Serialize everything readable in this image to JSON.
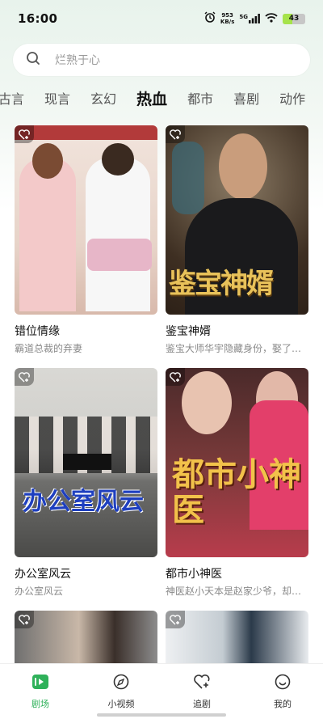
{
  "status": {
    "time": "16:00",
    "net_speed_value": "953",
    "net_speed_unit": "KB/s",
    "signal_label": "5G",
    "battery": "43"
  },
  "search": {
    "placeholder": "烂熟于心"
  },
  "tabs": [
    {
      "label": "古言",
      "active": false
    },
    {
      "label": "现言",
      "active": false
    },
    {
      "label": "玄幻",
      "active": false
    },
    {
      "label": "热血",
      "active": true
    },
    {
      "label": "都市",
      "active": false
    },
    {
      "label": "喜剧",
      "active": false
    },
    {
      "label": "动作",
      "active": false
    }
  ],
  "cards": [
    {
      "title": "错位情缘",
      "desc": "霸道总裁的弃妻",
      "poster_text": "",
      "palette": [
        "#d9c2b6",
        "#f2e4dc"
      ]
    },
    {
      "title": "鉴宝神婿",
      "desc": "鉴宝大师华宇隐藏身份，娶了…",
      "poster_text": "鉴宝神婿",
      "palette": [
        "#3b2a1c",
        "#7a6a55"
      ]
    },
    {
      "title": "办公室风云",
      "desc": "办公室风云",
      "poster_text": "办公室风云",
      "palette": [
        "#c9c9c6",
        "#8e8e8a"
      ]
    },
    {
      "title": "都市小神医",
      "desc": "神医赵小天本是赵家少爷，却…",
      "poster_text": "都市小神医",
      "palette": [
        "#5a2e2a",
        "#d94a5a"
      ]
    },
    {
      "title": "",
      "desc": "",
      "poster_text": "",
      "palette": [
        "#a7a7a7",
        "#5b4a40"
      ]
    },
    {
      "title": "",
      "desc": "",
      "poster_text": "",
      "palette": [
        "#dfe3e6",
        "#9aa4ab"
      ]
    }
  ],
  "nav": [
    {
      "label": "剧场",
      "icon": "theater-icon",
      "active": true
    },
    {
      "label": "小视频",
      "icon": "compass-icon",
      "active": false
    },
    {
      "label": "追剧",
      "icon": "heart-plus-icon",
      "active": false
    },
    {
      "label": "我的",
      "icon": "smile-icon",
      "active": false
    }
  ],
  "colors": {
    "accent": "#2fb15a"
  }
}
